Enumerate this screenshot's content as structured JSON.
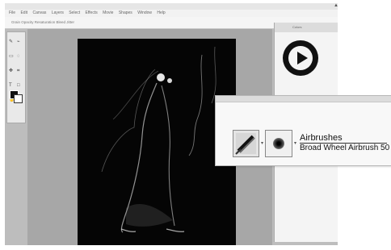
{
  "window": {
    "title": ""
  },
  "menu": {
    "items": [
      "File",
      "Edit",
      "Canvas",
      "Layers",
      "Select",
      "Effects",
      "Movie",
      "Shapes",
      "Window",
      "Help"
    ]
  },
  "options": {
    "text": "Grain  Opacity  Resaturation  Bleed  Jitter"
  },
  "colors": {
    "panel_bg": "#f4f4f4",
    "doc_bg": "#050505"
  },
  "right_panel": {
    "tab_label": "Colors"
  },
  "brush_selector": {
    "category": "Airbrushes",
    "variant": "Broad Wheel Airbrush 50"
  },
  "icons": {
    "brush_category": "airbrush-pen-icon",
    "brush_variant": "soft-dab-icon"
  }
}
